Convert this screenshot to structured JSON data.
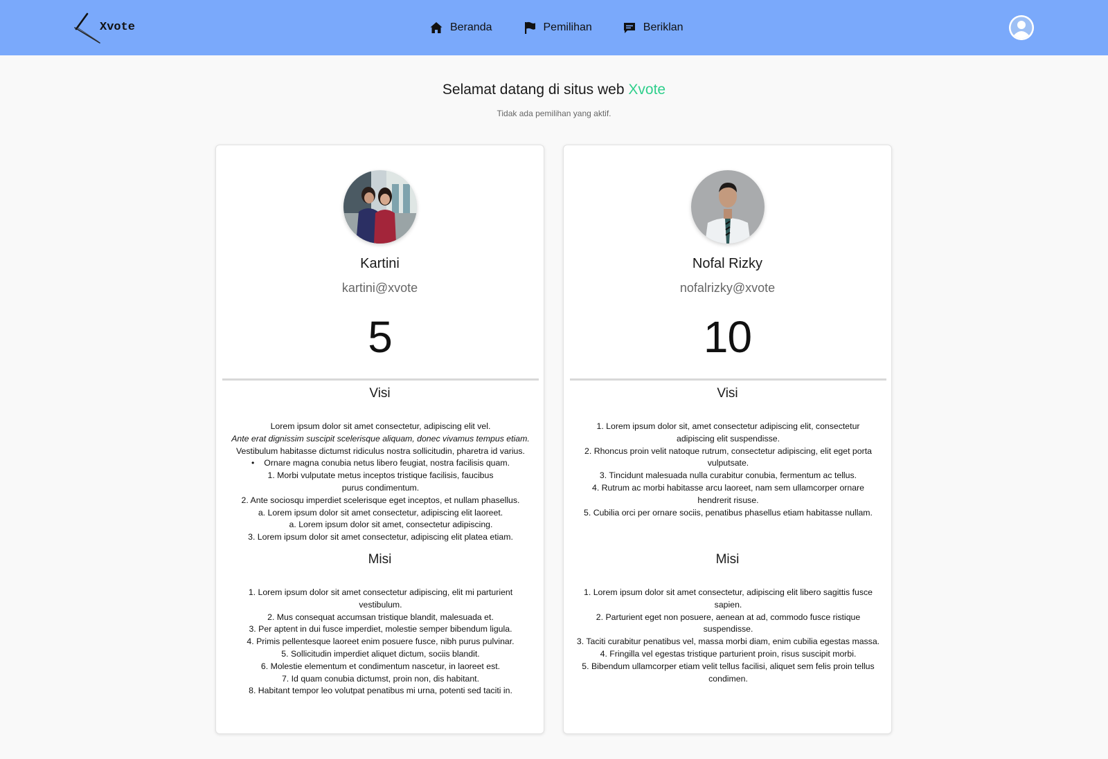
{
  "nav": {
    "brand": "Xvote",
    "links": [
      {
        "label": "Beranda",
        "icon": "home-icon"
      },
      {
        "label": "Pemilihan",
        "icon": "flag-icon"
      },
      {
        "label": "Beriklan",
        "icon": "ad-message-icon"
      }
    ],
    "profile_icon": "user-avatar-icon"
  },
  "header": {
    "welcome_prefix": "Selamat datang di situs web",
    "welcome_accent": "Xvote",
    "status": "Tidak ada pemilihan yang aktif."
  },
  "colors": {
    "navbar": "#7aa9fb",
    "accent": "#2fcf8c",
    "background": "#f9f9f9"
  },
  "candidates": [
    {
      "name": "Kartini",
      "email": "kartini@xvote",
      "votes": "5",
      "visi_title": "Visi",
      "visi_lines": [
        "Lorem ipsum dolor sit amet consectetur, adipiscing elit vel.",
        "Ante erat dignissim suscipit scelerisque aliquam, donec vivamus tempus etiam.",
        "Vestibulum habitasse dictumst ridiculus nostra sollicitudin, pharetra id varius.",
        "Ornare magna conubia netus libero feugiat, nostra facilisis quam.",
        "1. Morbi vulputate metus inceptos tristique facilisis, faucibus purus condimentum.",
        "2. Ante sociosqu imperdiet scelerisque eget inceptos, et nullam phasellus.",
        "a. Lorem ipsum dolor sit amet consectetur, adipiscing elit laoreet.",
        "a. Lorem ipsum dolor sit amet, consectetur adipiscing.",
        "3. Lorem ipsum dolor sit amet consectetur, adipiscing elit platea etiam."
      ],
      "misi_title": "Misi",
      "misi_lines": [
        "1. Lorem ipsum dolor sit amet consectetur adipiscing, elit mi parturient vestibulum.",
        "2. Mus consequat accumsan tristique blandit, malesuada et.",
        "3. Per aptent in dui fusce imperdiet, molestie semper bibendum ligula.",
        "4. Primis pellentesque laoreet enim posuere fusce, nibh purus pulvinar.",
        "5. Sollicitudin imperdiet aliquet dictum, sociis blandit.",
        "6. Molestie elementum et condimentum nascetur, in laoreet est.",
        "7. Id quam conubia dictumst, proin non, dis habitant.",
        "8. Habitant tempor leo volutpat penatibus mi urna, potenti sed taciti in."
      ]
    },
    {
      "name": "Nofal Rizky",
      "email": "nofalrizky@xvote",
      "votes": "10",
      "visi_title": "Visi",
      "visi_lines": [
        "1. Lorem ipsum dolor sit, amet consectetur adipiscing elit, consectetur adipiscing elit suspendisse.",
        "2. Rhoncus proin velit natoque rutrum, consectetur adipiscing, elit eget porta vulputsate.",
        "3. Tincidunt malesuada nulla curabitur conubia, fermentum ac tellus.",
        "4. Rutrum ac morbi habitasse arcu laoreet, nam sem ullamcorper ornare hendrerit risuse.",
        "5. Cubilia orci per ornare sociis, penatibus phasellus etiam habitasse nullam."
      ],
      "misi_title": "Misi",
      "misi_lines": [
        "1. Lorem ipsum dolor sit amet consectetur, adipiscing elit libero sagittis fusce sapien.",
        "2. Parturient eget non posuere, aenean at ad, commodo fusce ristique suspendisse.",
        "3. Taciti curabitur penatibus vel, massa morbi diam, enim cubilia egestas massa.",
        "4. Fringilla vel egestas tristique parturient proin, risus suscipit morbi.",
        "5. Bibendum ullamcorper etiam velit tellus facilisi, aliquet sem felis proin tellus condimen."
      ]
    }
  ]
}
